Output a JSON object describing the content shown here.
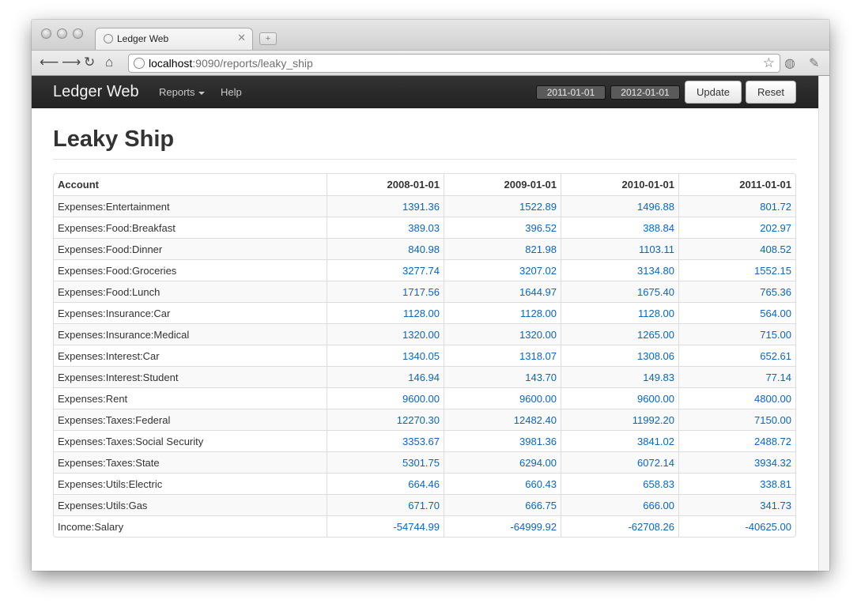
{
  "browser": {
    "tab_title": "Ledger Web",
    "url_host": "localhost",
    "url_rest": ":9090/reports/leaky_ship",
    "icons": [
      "back-icon",
      "forward-icon",
      "reload-icon",
      "home-icon",
      "star-icon",
      "globe-icon",
      "wrench-icon"
    ]
  },
  "navbar": {
    "brand": "Ledger Web",
    "reports_label": "Reports",
    "help_label": "Help",
    "from_date": "2011-01-01",
    "to_date": "2012-01-01",
    "update_label": "Update",
    "reset_label": "Reset"
  },
  "page": {
    "title": "Leaky Ship"
  },
  "table": {
    "headers": [
      "Account",
      "2008-01-01",
      "2009-01-01",
      "2010-01-01",
      "2011-01-01"
    ],
    "rows": [
      [
        "Expenses:Entertainment",
        "1391.36",
        "1522.89",
        "1496.88",
        "801.72"
      ],
      [
        "Expenses:Food:Breakfast",
        "389.03",
        "396.52",
        "388.84",
        "202.97"
      ],
      [
        "Expenses:Food:Dinner",
        "840.98",
        "821.98",
        "1103.11",
        "408.52"
      ],
      [
        "Expenses:Food:Groceries",
        "3277.74",
        "3207.02",
        "3134.80",
        "1552.15"
      ],
      [
        "Expenses:Food:Lunch",
        "1717.56",
        "1644.97",
        "1675.40",
        "765.36"
      ],
      [
        "Expenses:Insurance:Car",
        "1128.00",
        "1128.00",
        "1128.00",
        "564.00"
      ],
      [
        "Expenses:Insurance:Medical",
        "1320.00",
        "1320.00",
        "1265.00",
        "715.00"
      ],
      [
        "Expenses:Interest:Car",
        "1340.05",
        "1318.07",
        "1308.06",
        "652.61"
      ],
      [
        "Expenses:Interest:Student",
        "146.94",
        "143.70",
        "149.83",
        "77.14"
      ],
      [
        "Expenses:Rent",
        "9600.00",
        "9600.00",
        "9600.00",
        "4800.00"
      ],
      [
        "Expenses:Taxes:Federal",
        "12270.30",
        "12482.40",
        "11992.20",
        "7150.00"
      ],
      [
        "Expenses:Taxes:Social Security",
        "3353.67",
        "3981.36",
        "3841.02",
        "2488.72"
      ],
      [
        "Expenses:Taxes:State",
        "5301.75",
        "6294.00",
        "6072.14",
        "3934.32"
      ],
      [
        "Expenses:Utils:Electric",
        "664.46",
        "660.43",
        "658.83",
        "338.81"
      ],
      [
        "Expenses:Utils:Gas",
        "671.70",
        "666.75",
        "666.00",
        "341.73"
      ],
      [
        "Income:Salary",
        "-54744.99",
        "-64999.92",
        "-62708.26",
        "-40625.00"
      ]
    ]
  },
  "colors": {
    "navbar_bg": "#222222",
    "link_blue": "#0866c6"
  }
}
